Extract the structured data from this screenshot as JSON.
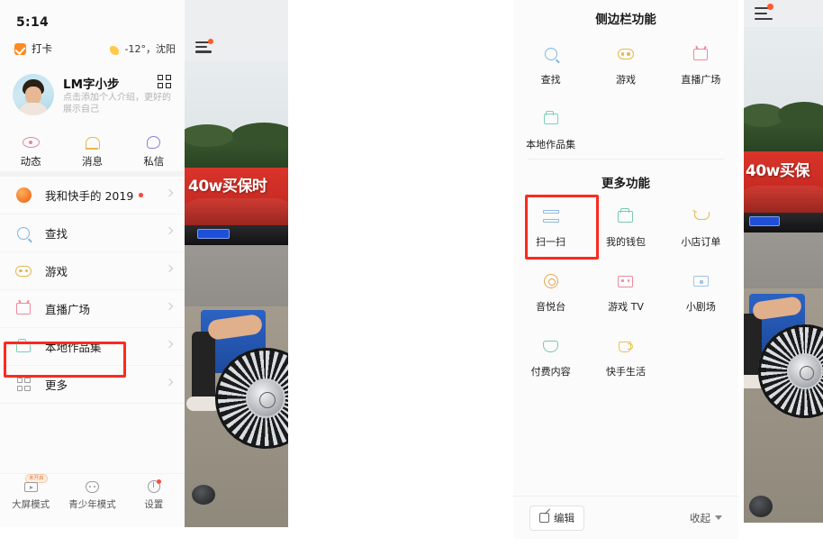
{
  "left_phone": {
    "status_bar": {
      "time": "5:14",
      "signal_icon": "signal-bars-icon",
      "wifi_icon": "wifi-icon",
      "battery_icon": "battery-charging-icon"
    },
    "top_row": {
      "checkin_label": "打卡",
      "checkin_icon": "checkbox-checked-icon",
      "weather_icon": "moon-icon",
      "weather_text": "-12°，沈阳"
    },
    "profile": {
      "avatar": "user-avatar",
      "name": "LM字小步",
      "qr_icon": "qr-code-icon",
      "description": "点击添加个人介绍，更好的展示自己"
    },
    "tabs": [
      {
        "icon": "eye-icon",
        "label": "动态"
      },
      {
        "icon": "bell-icon",
        "label": "消息"
      },
      {
        "icon": "chat-bubble-icon",
        "label": "私信"
      }
    ],
    "menu": [
      {
        "icon": "pumpkin-icon",
        "label": "我和快手的 2019",
        "has_dot": true
      },
      {
        "icon": "search-icon",
        "label": "查找",
        "has_dot": false
      },
      {
        "icon": "game-icon",
        "label": "游戏",
        "has_dot": false
      },
      {
        "icon": "live-icon",
        "label": "直播广场",
        "has_dot": false
      },
      {
        "icon": "folder-icon",
        "label": "本地作品集",
        "has_dot": false
      },
      {
        "icon": "grid-icon",
        "label": "更多",
        "has_dot": false
      }
    ],
    "bottom_tabs": [
      {
        "icon": "tv-icon",
        "label": "大屏模式",
        "badge": "未开启"
      },
      {
        "icon": "teen-face-icon",
        "label": "青少年模式",
        "badge": ""
      },
      {
        "icon": "gear-icon",
        "label": "设置",
        "badge": ""
      }
    ],
    "video": {
      "menu_icon": "hamburger-menu-icon",
      "overlay_text": "40w买保时"
    }
  },
  "sheet": {
    "section1_title": "侧边栏功能",
    "section1_items": [
      {
        "icon": "search-icon",
        "label": "查找"
      },
      {
        "icon": "game-icon",
        "label": "游戏"
      },
      {
        "icon": "live-icon",
        "label": "直播广场"
      },
      {
        "icon": "folder-icon",
        "label": "本地作品集"
      }
    ],
    "section2_title": "更多功能",
    "section2_items": [
      {
        "icon": "scan-icon",
        "label": "扫一扫"
      },
      {
        "icon": "wallet-icon",
        "label": "我的钱包"
      },
      {
        "icon": "cart-icon",
        "label": "小店订单"
      },
      {
        "icon": "music-icon",
        "label": "音悦台"
      },
      {
        "icon": "game-tv-icon",
        "label": "游戏 TV"
      },
      {
        "icon": "screen-icon",
        "label": "小剧场"
      },
      {
        "icon": "paid-content-icon",
        "label": "付费内容"
      },
      {
        "icon": "cup-icon",
        "label": "快手生活"
      }
    ],
    "footer": {
      "edit_icon": "edit-icon",
      "edit_label": "编辑",
      "collapse_label": "收起",
      "collapse_icon": "caret-down-icon"
    }
  },
  "right_phone": {
    "menu_icon": "hamburger-menu-icon",
    "overlay_text": "40w买保"
  },
  "annotations": {
    "highlight_color": "#fd2a1e",
    "boxes": [
      {
        "name": "more-menu-highlight"
      },
      {
        "name": "scan-item-highlight"
      }
    ]
  }
}
